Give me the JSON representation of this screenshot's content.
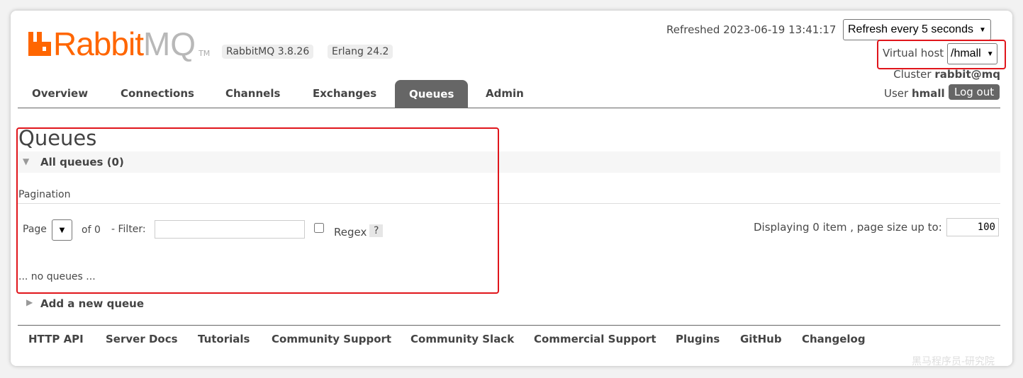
{
  "header": {
    "logo_text": "RabbitMQ",
    "logo_tm": "TM",
    "version_badge": "RabbitMQ 3.8.26",
    "erlang_badge": "Erlang 24.2",
    "refreshed": "Refreshed 2023-06-19 13:41:17",
    "refresh_select": "Refresh every 5 seconds",
    "vhost_label": "Virtual host",
    "vhost_select": "/hmall",
    "cluster_label": "Cluster",
    "cluster_name": "rabbit@mq",
    "user_label": "User",
    "user_name": "hmall",
    "logout": "Log out"
  },
  "tabs": [
    {
      "label": "Overview"
    },
    {
      "label": "Connections"
    },
    {
      "label": "Channels"
    },
    {
      "label": "Exchanges"
    },
    {
      "label": "Queues",
      "active": true
    },
    {
      "label": "Admin"
    }
  ],
  "main": {
    "title": "Queues",
    "section": "All queues (0)",
    "pagination": "Pagination",
    "page_label": "Page",
    "of_label": "of 0",
    "filter_label": "- Filter:",
    "filter_value": "",
    "regex_label": "Regex",
    "help": "?",
    "displaying": "Displaying 0 item , page size up to:",
    "page_size": "100",
    "empty": "... no queues ...",
    "add_queue": "Add a new queue"
  },
  "footer": {
    "links": [
      "HTTP API",
      "Server Docs",
      "Tutorials",
      "Community Support",
      "Community Slack",
      "Commercial Support",
      "Plugins",
      "GitHub",
      "Changelog"
    ]
  },
  "watermark": "黑马程序员-研究院",
  "colors": {
    "brand": "#ff6600",
    "highlight": "#e0151b",
    "active_tab": "#666666"
  }
}
